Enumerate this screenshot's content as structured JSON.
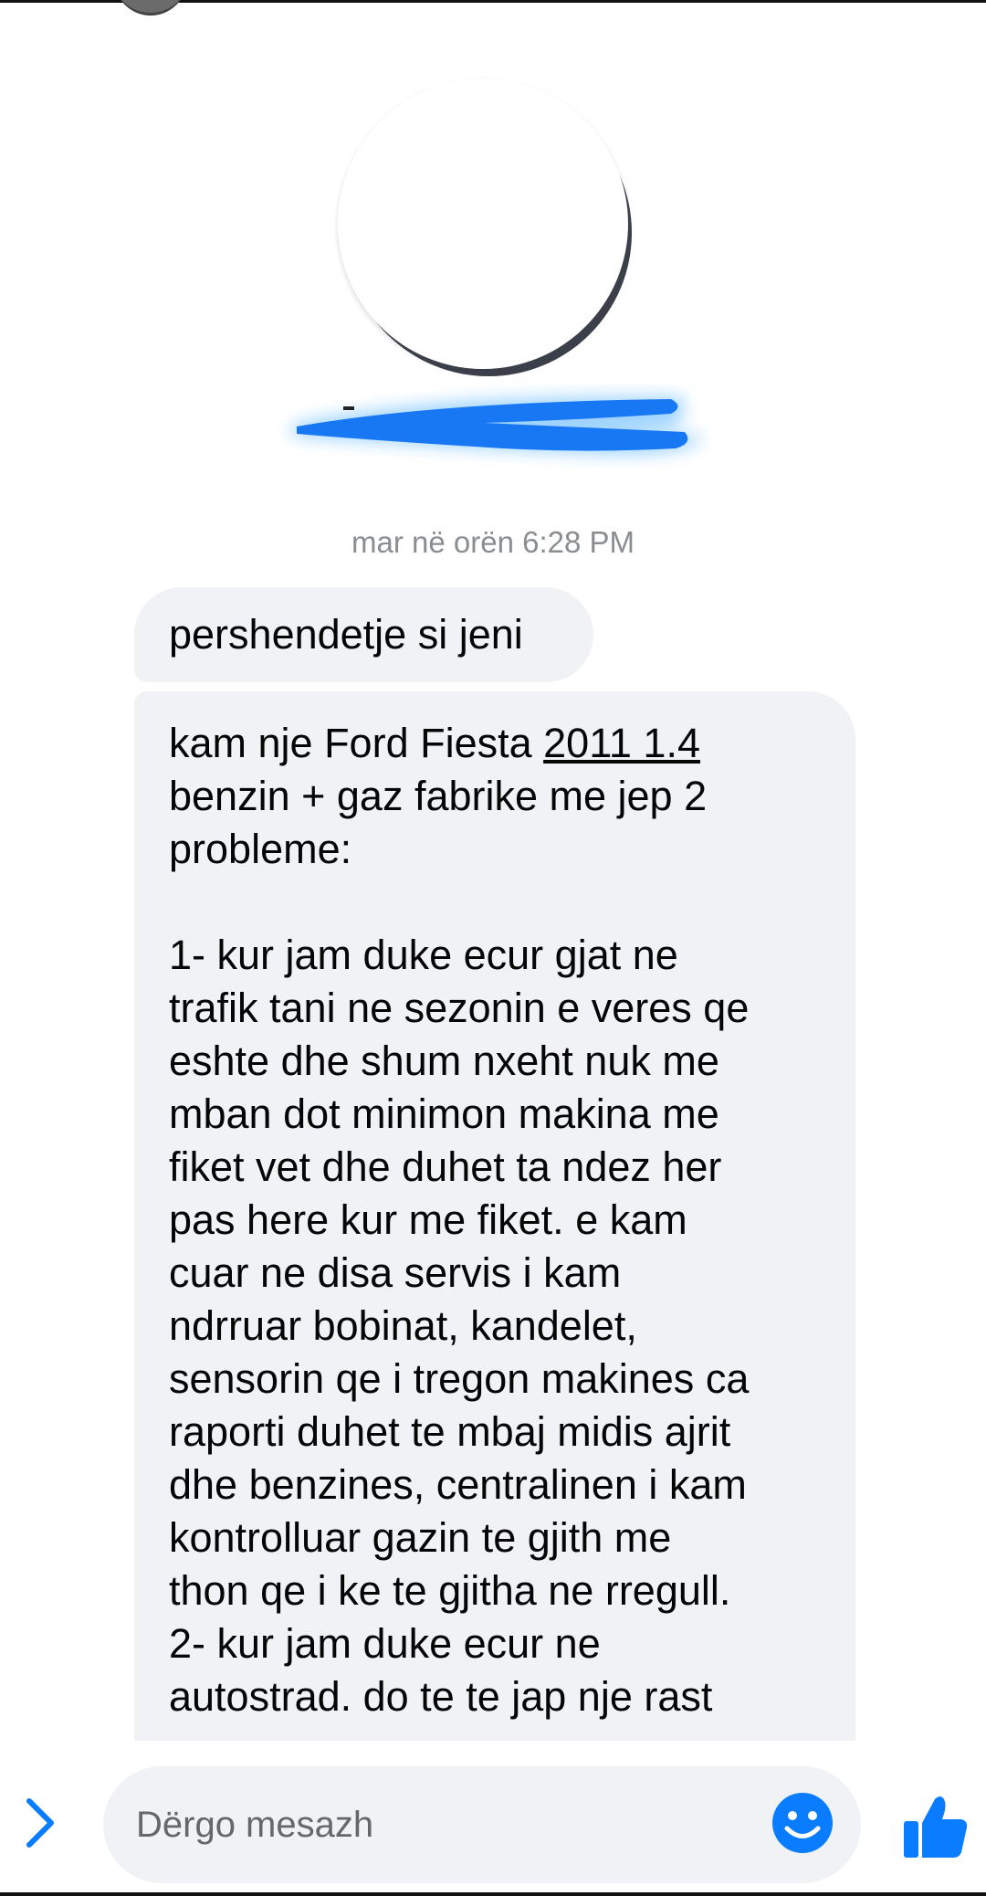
{
  "conversation": {
    "timestamp": "mar në orën 6:28 PM"
  },
  "messages": [
    {
      "lines": [
        "persshendetje si jeni"
      ]
    }
  ],
  "first_message": "pershendetje si jeni",
  "second_message": {
    "line1_prefix": "kam nje Ford Fiesta ",
    "line1_link": "2011 1.4",
    "lines": [
      "benzin + gaz fabrike me jep 2",
      "probleme:",
      "",
      "1- kur jam duke ecur gjat ne",
      "trafik tani ne sezonin e veres qe",
      "eshte dhe shum nxeht nuk me",
      "mban dot minimon makina me",
      "fiket vet dhe duhet ta ndez her",
      "pas here kur me fiket. e kam",
      "cuar ne disa servis i kam",
      "ndrruar bobinat, kandelet,",
      "sensorin qe i tregon makines ca",
      "raporti duhet te mbaj midis ajrit",
      "dhe benzines, centralinen i kam",
      "kontrolluar gazin te gjith me",
      "thon qe i ke te gjitha ne rregull.",
      "2- kur jam duke ecur ne",
      "autostrad. do te te jap nje rast"
    ]
  },
  "composer": {
    "placeholder": "Dërgo mesazh",
    "expand_icon": "chevron-right-icon",
    "emoji_icon": "smiley-icon",
    "like_icon": "thumbs-up-icon"
  },
  "colors": {
    "accent": "#0a7cff",
    "bubble": "#f0f2f5",
    "timestamp": "#8a8d91",
    "placeholder": "#65676b",
    "redaction": "#1877f2"
  }
}
